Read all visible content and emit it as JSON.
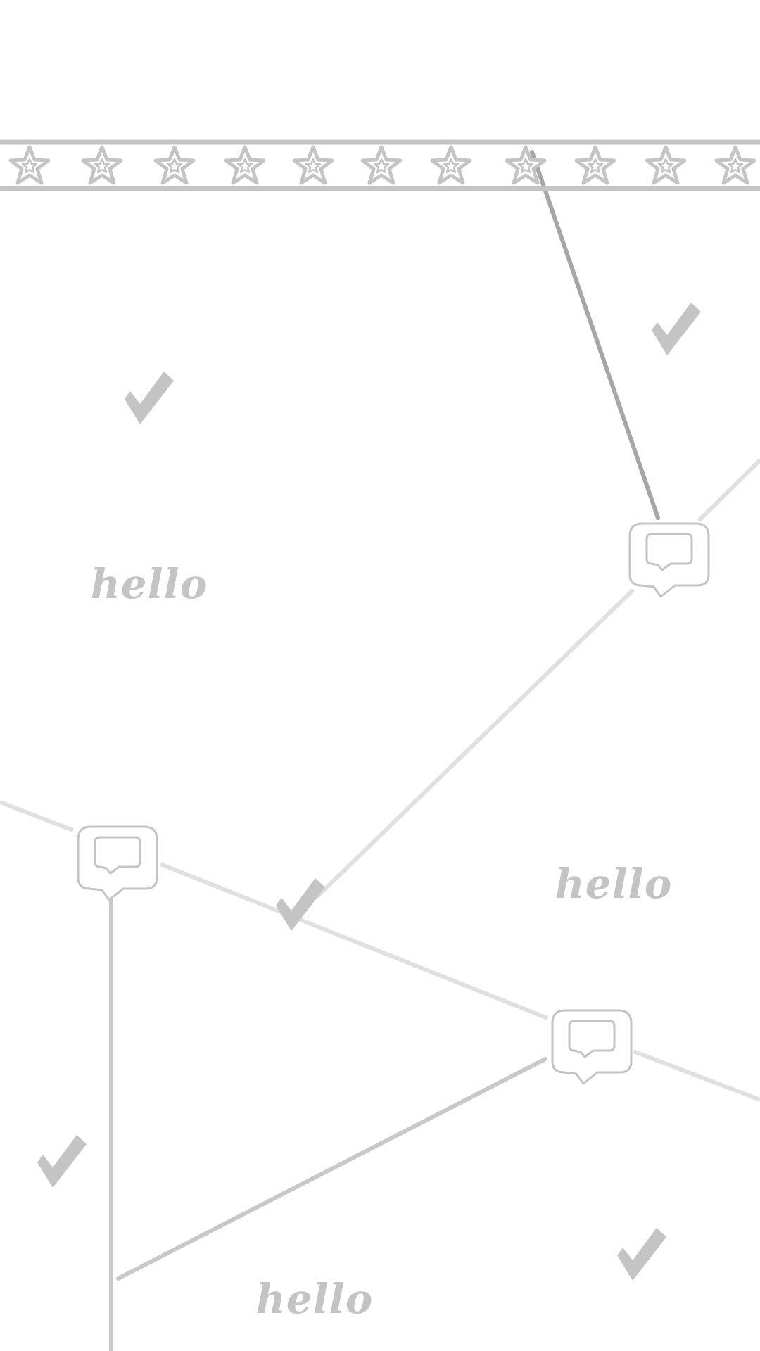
{
  "words": {
    "hello_1": "hello",
    "hello_2": "hello",
    "hello_3": "hello"
  },
  "icons": {
    "star": "star-icon",
    "check": "checkmark-icon",
    "bubble": "speech-bubble-icon"
  },
  "colors": {
    "background": "#ffffff",
    "icon_gray": "#c4c4c4",
    "line_light": "#e0e0e0",
    "line_mid": "#c8c8c8",
    "line_dark": "#a6a6a6"
  }
}
